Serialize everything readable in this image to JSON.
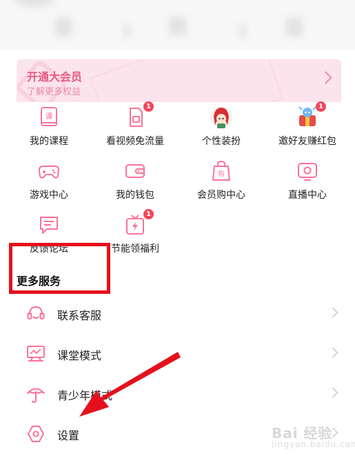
{
  "vip_banner": {
    "title": "开通大会员",
    "subtitle": "了解更多权益"
  },
  "grid": [
    {
      "label": "我的课程",
      "icon": "course-icon",
      "badge": ""
    },
    {
      "label": "看视频免流量",
      "icon": "sim-card-icon",
      "badge": "1"
    },
    {
      "label": "个性装扮",
      "icon": "avatar-character-icon",
      "badge": ""
    },
    {
      "label": "邀好友赚红包",
      "icon": "invite-mascot-icon",
      "badge": "1"
    },
    {
      "label": "游戏中心",
      "icon": "gamepad-icon",
      "badge": ""
    },
    {
      "label": "我的钱包",
      "icon": "wallet-icon",
      "badge": ""
    },
    {
      "label": "会员购中心",
      "icon": "shopping-bag-icon",
      "badge": ""
    },
    {
      "label": "直播中心",
      "icon": "live-tv-icon",
      "badge": ""
    },
    {
      "label": "反馈论坛",
      "icon": "feedback-chat-icon",
      "badge": ""
    },
    {
      "label": "节能领福利",
      "icon": "gift-bolt-icon",
      "badge": "1"
    }
  ],
  "section": {
    "title": "更多服务"
  },
  "services": [
    {
      "label": "联系客服",
      "icon": "headset-icon"
    },
    {
      "label": "课堂模式",
      "icon": "classroom-board-icon"
    },
    {
      "label": "青少年模式",
      "icon": "umbrella-icon"
    },
    {
      "label": "设置",
      "icon": "settings-hexagon-icon"
    }
  ],
  "watermark": {
    "brand": "Bai 经验",
    "domain": "jingyan.baidu.com"
  },
  "colors": {
    "accent": "#fb7299",
    "annotation": "#e5101d",
    "badge": "#f5455b"
  }
}
